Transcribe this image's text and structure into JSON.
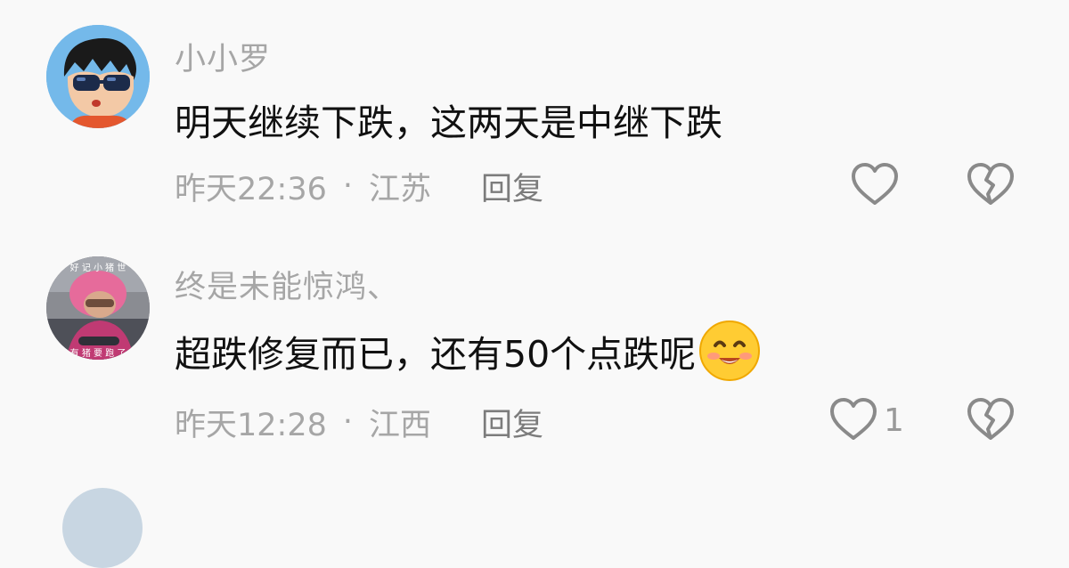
{
  "comments": [
    {
      "username": "小小罗",
      "text": "明天继续下跌，这两天是中继下跌",
      "time": "昨天22:36",
      "separator": "·",
      "location": "江苏",
      "reply_label": "回复",
      "like_count": "",
      "avatar": "cartoon-boy-sunglasses"
    },
    {
      "username": "终是未能惊鸿、",
      "text": "超跌修复而已，还有50个点跌呢",
      "emoji": "smiling-face-emoji",
      "time": "昨天12:28",
      "separator": "·",
      "location": "江西",
      "reply_label": "回复",
      "like_count": "1",
      "avatar": "photo-pink-helmet"
    }
  ],
  "colors": {
    "background": "#f9f9f9",
    "username": "#a6a6a6",
    "text": "#111111",
    "meta": "#a6a6a6",
    "reply": "#7c7c7c",
    "icon": "#8a8a8a"
  }
}
